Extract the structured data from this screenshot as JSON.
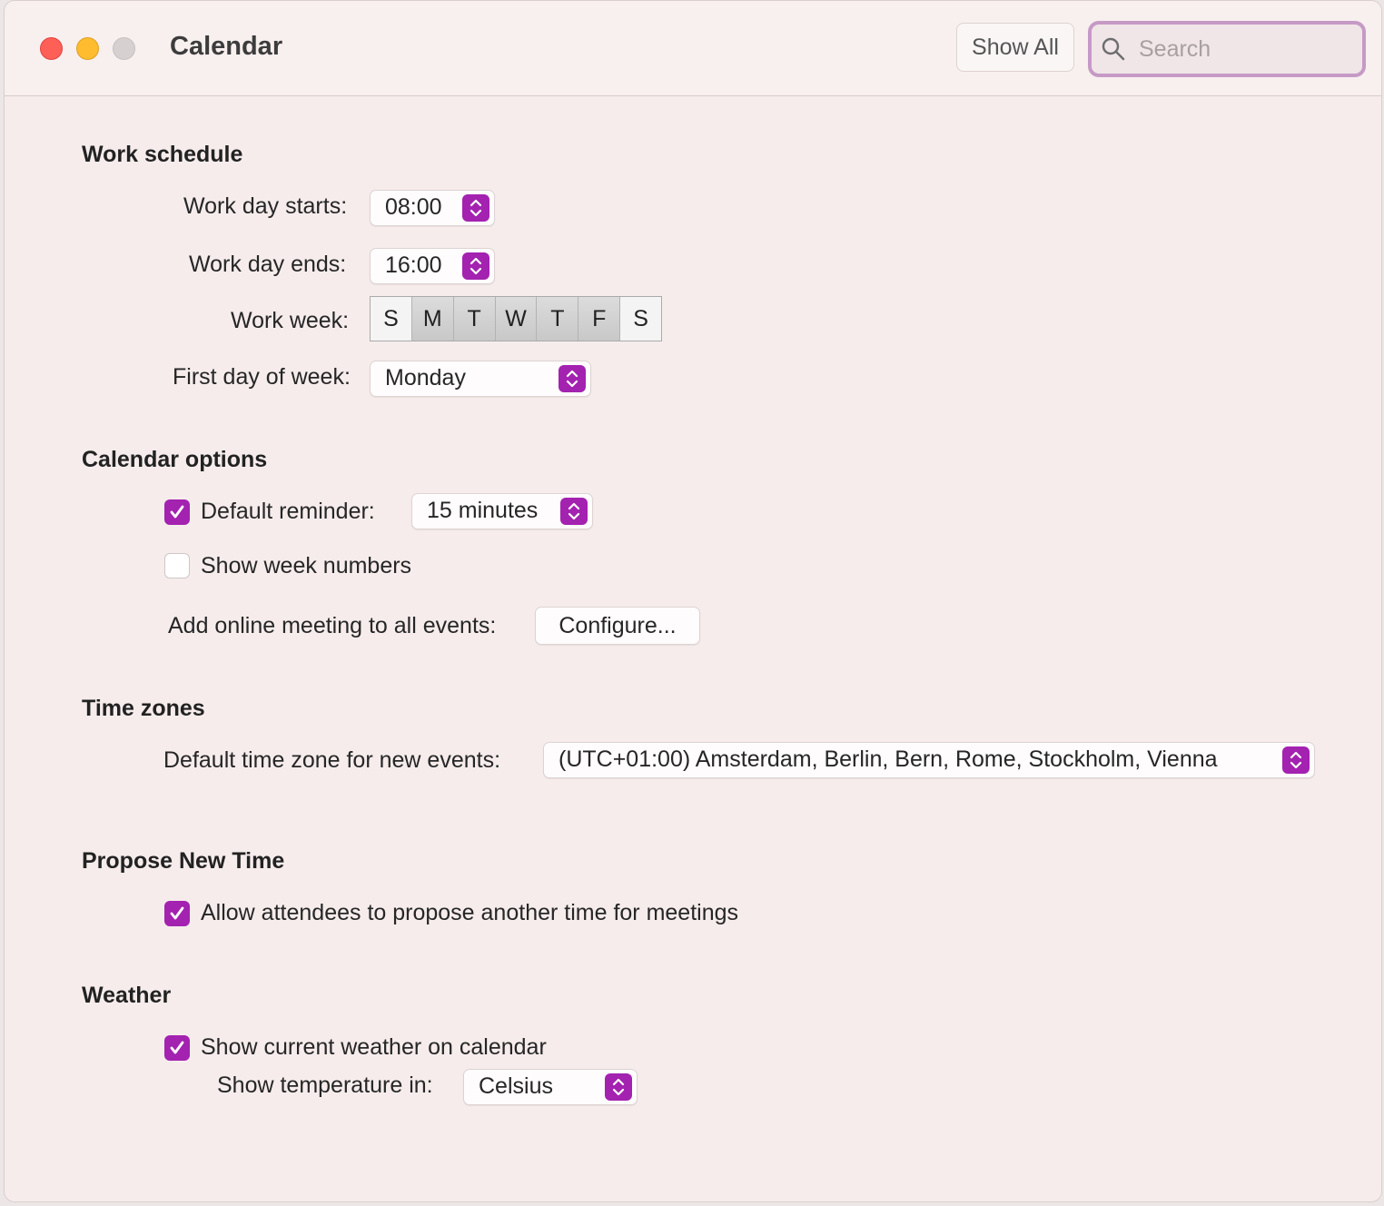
{
  "window": {
    "title": "Calendar",
    "show_all_label": "Show All",
    "search_placeholder": "Search"
  },
  "work_schedule": {
    "heading": "Work schedule",
    "day_starts_label": "Work day starts:",
    "day_starts_value": "08:00",
    "day_ends_label": "Work day ends:",
    "day_ends_value": "16:00",
    "work_week_label": "Work week:",
    "days": [
      {
        "letter": "S",
        "selected": false
      },
      {
        "letter": "M",
        "selected": true
      },
      {
        "letter": "T",
        "selected": true
      },
      {
        "letter": "W",
        "selected": true
      },
      {
        "letter": "T",
        "selected": true
      },
      {
        "letter": "F",
        "selected": true
      },
      {
        "letter": "S",
        "selected": false
      }
    ],
    "first_day_label": "First day of week:",
    "first_day_value": "Monday"
  },
  "calendar_options": {
    "heading": "Calendar options",
    "default_reminder_label": "Default reminder:",
    "default_reminder_checked": true,
    "default_reminder_value": "15 minutes",
    "week_numbers_label": "Show week numbers",
    "week_numbers_checked": false,
    "online_meeting_label": "Add online meeting to all events:",
    "configure_label": "Configure..."
  },
  "time_zones": {
    "heading": "Time zones",
    "default_tz_label": "Default time zone for new events:",
    "default_tz_value": "(UTC+01:00) Amsterdam, Berlin, Bern, Rome, Stockholm, Vienna"
  },
  "propose_new_time": {
    "heading": "Propose New Time",
    "allow_label": "Allow attendees to propose another time for meetings",
    "allow_checked": true
  },
  "weather": {
    "heading": "Weather",
    "show_weather_label": "Show current weather on calendar",
    "show_weather_checked": true,
    "temperature_label": "Show temperature in:",
    "temperature_value": "Celsius"
  },
  "colors": {
    "accent": "#a322b0",
    "close": "#fe5f57",
    "minimize": "#febc2e",
    "search_focus": "#c59ac5"
  }
}
